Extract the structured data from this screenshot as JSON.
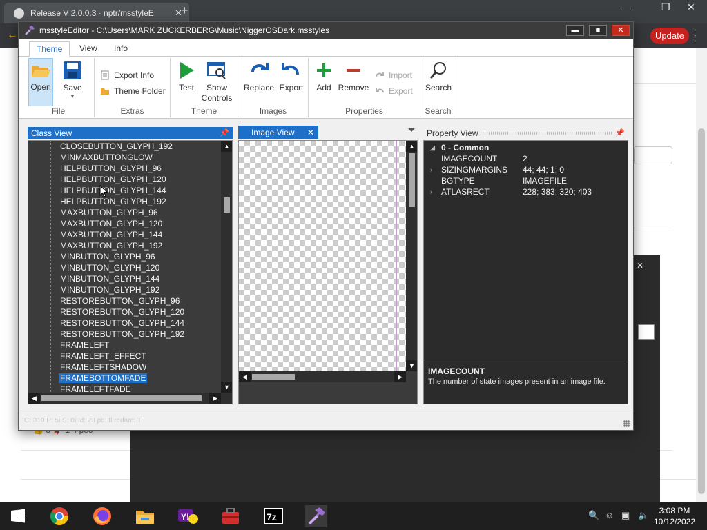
{
  "browser": {
    "tab_title": "Release V 2.0.0.3 · nptr/msstyleE",
    "tab_close": "✕",
    "new_tab": "+",
    "update_label": "Update",
    "reactions": "👍 3    🚀 1    4 peo"
  },
  "app": {
    "title": "msstyleEditor - C:\\Users\\MARK ZUCKERBERG\\Music\\NiggerOSDark.msstyles",
    "controls": {
      "minimize": "▬",
      "maximize": "■",
      "close": "✕"
    },
    "menu_tabs": [
      {
        "label": "Theme"
      },
      {
        "label": "View"
      },
      {
        "label": "Info"
      }
    ],
    "ribbon": {
      "file": {
        "label": "File",
        "open": "Open",
        "save": "Save"
      },
      "extras": {
        "label": "Extras",
        "export_info": "Export Info",
        "theme_folder": "Theme Folder"
      },
      "theme": {
        "label": "Theme",
        "test": "Test",
        "show_controls_1": "Show",
        "show_controls_2": "Controls"
      },
      "images": {
        "label": "Images",
        "replace": "Replace",
        "export": "Export"
      },
      "properties": {
        "label": "Properties",
        "add": "Add",
        "remove": "Remove",
        "import": "Import",
        "export": "Export"
      },
      "search": {
        "label": "Search",
        "search": "Search"
      }
    },
    "class_view": {
      "title": "Class View",
      "items": [
        "CLOSEBUTTON_GLYPH_192",
        "MINMAXBUTTONGLOW",
        "HELPBUTTON_GLYPH_96",
        "HELPBUTTON_GLYPH_120",
        "HELPBUTTON_GLYPH_144",
        "HELPBUTTON_GLYPH_192",
        "MAXBUTTON_GLYPH_96",
        "MAXBUTTON_GLYPH_120",
        "MAXBUTTON_GLYPH_144",
        "MAXBUTTON_GLYPH_192",
        "MINBUTTON_GLYPH_96",
        "MINBUTTON_GLYPH_120",
        "MINBUTTON_GLYPH_144",
        "MINBUTTON_GLYPH_192",
        "RESTOREBUTTON_GLYPH_96",
        "RESTOREBUTTON_GLYPH_120",
        "RESTOREBUTTON_GLYPH_144",
        "RESTOREBUTTON_GLYPH_192",
        "FRAMELEFT",
        "FRAMELEFT_EFFECT",
        "FRAMELEFTSHADOW",
        "FRAMEBOTTOMFADE",
        "FRAMELEFTFADE"
      ],
      "selected_index": 21
    },
    "image_view": {
      "title": "Image View",
      "close": "✕"
    },
    "property_view": {
      "title": "Property View",
      "group": "0 - Common",
      "properties": [
        {
          "key": "IMAGECOUNT",
          "value": "2",
          "expandable": false
        },
        {
          "key": "SIZINGMARGINS",
          "value": "44; 44; 1; 0",
          "expandable": true
        },
        {
          "key": "BGTYPE",
          "value": "IMAGEFILE",
          "expandable": false
        },
        {
          "key": "ATLASRECT",
          "value": "228; 383; 320; 403",
          "expandable": true
        }
      ],
      "description_title": "IMAGECOUNT",
      "description_text": "The number of state images present in an image file."
    },
    "status_text": "C: 310 P: 5i    S: 0i    Id: 23 pd: tl redam: T"
  },
  "taskbar": {
    "time": "3:08 PM",
    "date": "10/12/2022",
    "apps": [
      "windows-start",
      "chrome",
      "firefox",
      "file-explorer",
      "yahoo",
      "toolbox",
      "7zip",
      "msstyleeditor"
    ]
  },
  "colors": {
    "accent": "#1e6fc8",
    "pane_dark": "#3b3b3b",
    "titlebar": "#3c3c3c",
    "close_red": "#c42b1c",
    "green": "#1e9e3a",
    "update_red": "#c5221f"
  }
}
